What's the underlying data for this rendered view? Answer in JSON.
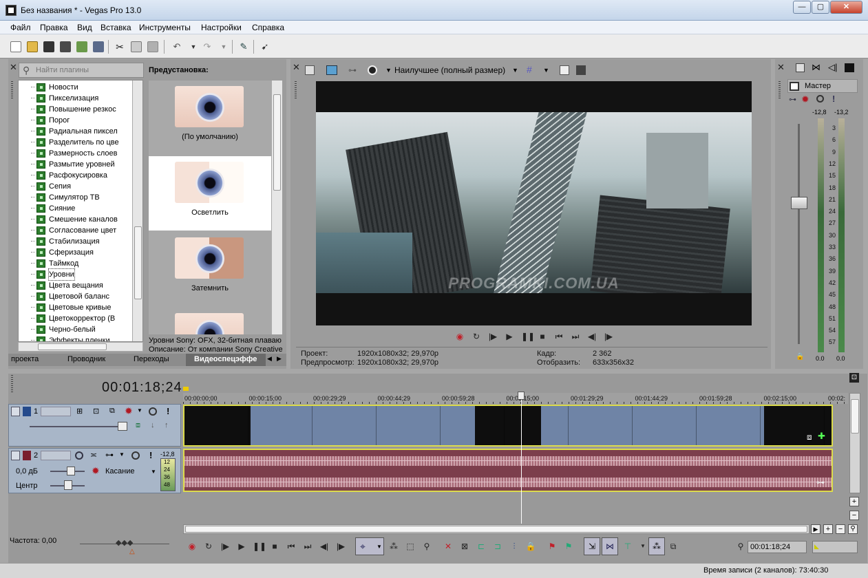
{
  "window": {
    "title": "Без названия * - Vegas Pro 13.0"
  },
  "menu": [
    "Файл",
    "Правка",
    "Вид",
    "Вставка",
    "Инструменты",
    "Настройки",
    "Справка"
  ],
  "plugins": {
    "search_placeholder": "Найти плагины",
    "items": [
      "Новости",
      "Пикселизация",
      "Повышение резкос",
      "Порог",
      "Радиальная пиксел",
      "Разделитель по цве",
      "Размерность слоев",
      "Размытие уровней",
      "Расфокусировка",
      "Сепия",
      "Симулятор ТВ",
      "Сияние",
      "Смешение каналов",
      "Согласование цвет",
      "Стабилизация",
      "Сферизация",
      "Таймкод",
      "Уровни",
      "Цвета вещания",
      "Цветовой баланс",
      "Цветовые кривые",
      "Цветокорректор (В",
      "Черно-белый",
      "Эффекты пленки"
    ],
    "selected": "Уровни",
    "tabs": [
      "проекта",
      "Проводник",
      "Переходы",
      "Видеоспецэффе"
    ]
  },
  "presets": {
    "header": "Предустановка:",
    "items": [
      "(По умолчанию)",
      "Осветлить",
      "Затемнить"
    ],
    "selected": "Осветлить",
    "description_line1": "Уровни Sony: OFX, 32-битная плаваю",
    "description_line2": "Описание: От компании Sony Creative"
  },
  "preview": {
    "quality": "Наилучшее (полный размер)",
    "watermark": "PROGRAMKI.COM.UA",
    "project_label": "Проект:",
    "project_value": "1920x1080x32; 29,970p",
    "preview_label": "Предпросмотр:",
    "preview_value": "1920x1080x32; 29,970p",
    "frame_label": "Кадр:",
    "frame_value": "2 362",
    "display_label": "Отобразить:",
    "display_value": "633x356x32"
  },
  "mixer": {
    "title": "Мастер",
    "peak_left": "-12,8",
    "peak_right": "-13,2",
    "scale": [
      "3",
      "6",
      "9",
      "12",
      "15",
      "18",
      "21",
      "24",
      "27",
      "30",
      "33",
      "36",
      "39",
      "42",
      "45",
      "48",
      "51",
      "54",
      "57"
    ],
    "bottom_left": "0.0",
    "bottom_right": "0.0"
  },
  "timeline": {
    "timecode": "00:01:18;24",
    "ruler": [
      "00:00:00;00",
      "00:00:15;00",
      "00:00:29;29",
      "00:00:44;29",
      "00:00:59;28",
      "00:01:15;00",
      "00:01:29;29",
      "00:01:44;29",
      "00:01:59;28",
      "00:02:15;00",
      "00:02:"
    ],
    "video_track_number": "1",
    "audio_track_number": "2",
    "audio_peak": "-12,8",
    "volume": "0,0 дБ",
    "pan": "Центр",
    "automation": "Касание",
    "meter_ticks": [
      "12",
      "24",
      "36",
      "48"
    ],
    "rate": "Частота: 0,00",
    "cursor_time": "00:01:18;24"
  },
  "status": {
    "record_time": "Время записи (2 каналов): 73:40:30"
  },
  "colors": {
    "video_event": "#6f84a6",
    "audio_event": "#7c3e4c",
    "event_border": "#dcdc4c",
    "track_header": "#a8b6c8"
  }
}
